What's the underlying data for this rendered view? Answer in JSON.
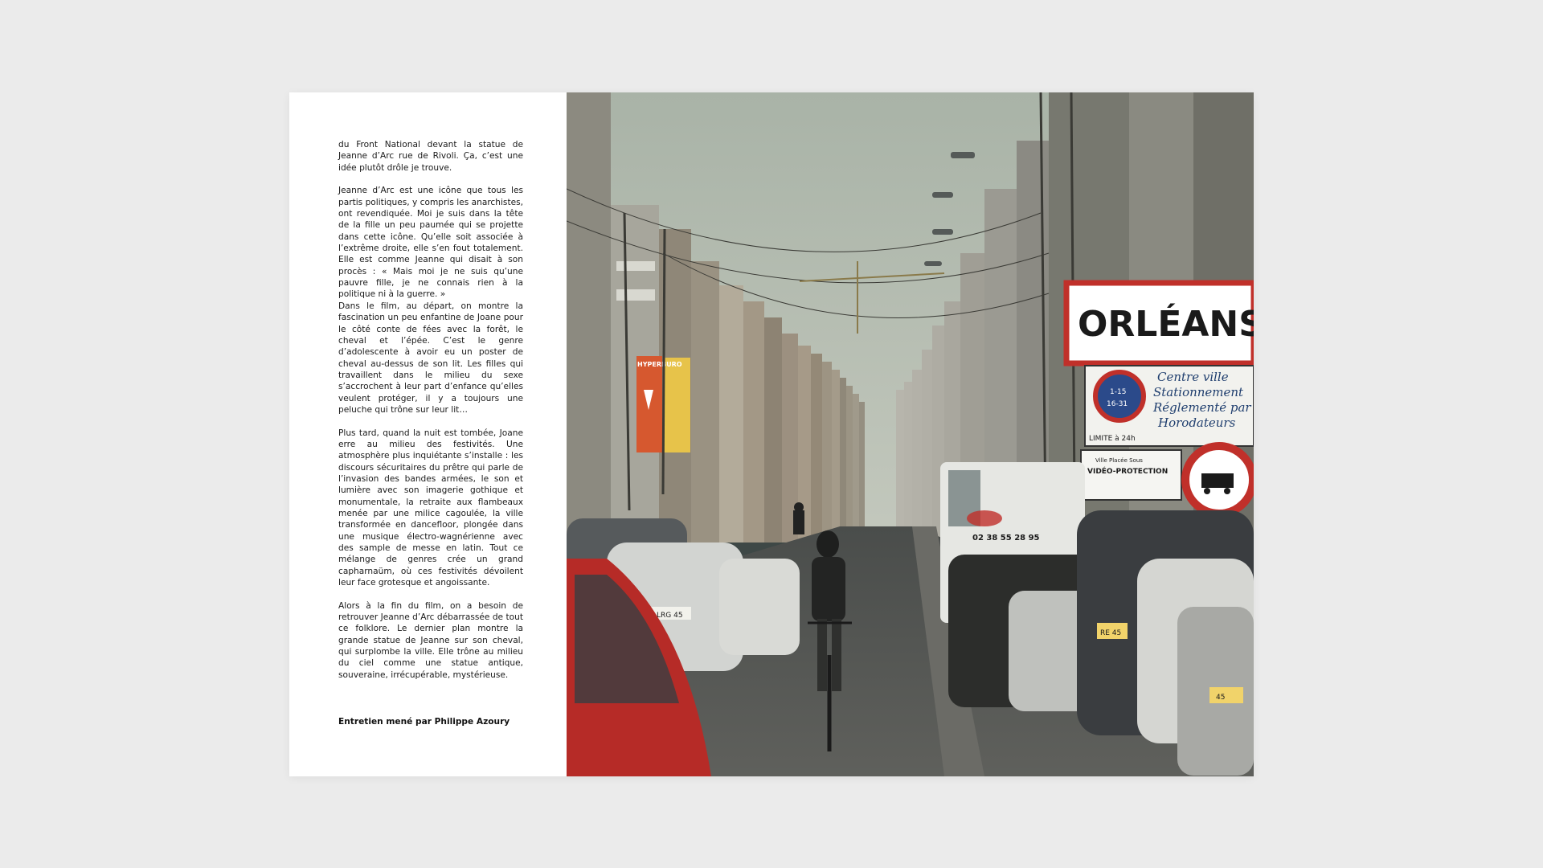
{
  "article": {
    "paragraphs": [
      "du Front National devant la statue de Jeanne d’Arc rue de Rivoli. Ça, c’est une idée plutôt drôle je trouve.",
      "Jeanne d’Arc est une icône que tous les partis politiques, y compris les anarchistes, ont revendiquée. Moi je suis dans la tête de la fille un peu paumée qui se projette dans cette icône. Qu’elle soit associée à l’extrême droite, elle s’en fout totalement. Elle est comme Jeanne qui disait à son procès : « Mais moi je ne suis qu’une pauvre fille, je ne connais rien à la politique ni à la guerre. »",
      "Dans le film, au départ, on montre la fascination un peu enfantine de Joane pour le côté conte de fées avec la forêt, le cheval et l’épée. C’est le genre d’adolescente à avoir eu un poster de cheval au-dessus de son lit. Les filles qui travaillent dans le milieu du sexe s’accrochent à leur part d’enfance qu’elles veulent protéger, il y a toujours une peluche qui trône sur leur lit…",
      "Plus tard, quand la nuit est tombée, Joane erre au milieu des festivités. Une atmosphère plus inquiétante s’installe : les discours sécuritaires du prêtre qui parle de l’invasion des bandes armées, le son et lumière avec son imagerie gothique et monumentale, la retraite aux flambeaux menée par une milice cagoulée, la ville transformée en dancefloor, plongée dans une musique électro-wagnérienne avec des sample de messe en latin. Tout ce mélange de genres crée un grand capharnaüm, où ces festivités dévoilent leur face grotesque et angoissante.",
      "Alors à la fin du film, on a besoin de retrouver Jeanne d’Arc débarrassée de tout ce folklore. Le dernier plan montre la grande statue de Jeanne sur son cheval, qui surplombe la ville. Elle trône au milieu du ciel comme une statue antique, souveraine, irrécupérable, mystérieuse."
    ],
    "credit": "Entretien mené par Philippe Azoury"
  },
  "photo": {
    "signs": {
      "town": "ORLÉANS",
      "parking_lines": [
        "Centre ville",
        "Stationnement",
        "Réglementé par",
        "Horodateurs"
      ],
      "limit": "LIMITE à 24h",
      "parking_hours": "1-15",
      "parking_hours_2": "16-31",
      "video": "VIDÉO-PROTECTION",
      "video_top": "Ville Placée Sous",
      "van_phone": "02 38 55 28 95",
      "store": "HYPERBURO",
      "plate_1": "LRG 45",
      "plate_2": "RE 45",
      "plate_3": "45"
    }
  },
  "colors": {
    "background": "#ebebeb",
    "page": "#ffffff",
    "text": "#1a1a1a",
    "sign_red": "#c0302a",
    "sky": "#b7bfb4"
  }
}
